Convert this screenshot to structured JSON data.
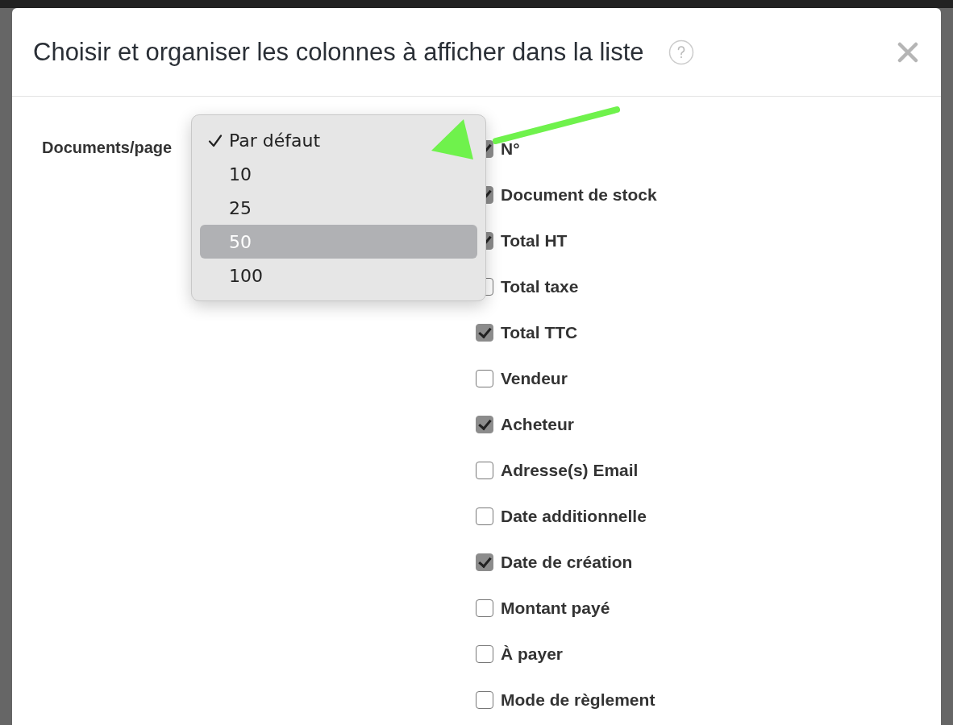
{
  "dialog": {
    "title": "Choisir et organiser les colonnes à afficher dans la liste",
    "page_size": {
      "label": "Documents/page",
      "options": [
        {
          "label": "Par défaut",
          "selected": true,
          "highlighted": false
        },
        {
          "label": "10",
          "selected": false,
          "highlighted": false
        },
        {
          "label": "25",
          "selected": false,
          "highlighted": false
        },
        {
          "label": "50",
          "selected": false,
          "highlighted": true
        },
        {
          "label": "100",
          "selected": false,
          "highlighted": false
        }
      ]
    },
    "columns": [
      {
        "label": "N°",
        "checked": true
      },
      {
        "label": "Document de stock",
        "checked": true
      },
      {
        "label": "Total HT",
        "checked": true
      },
      {
        "label": "Total taxe",
        "checked": false
      },
      {
        "label": "Total TTC",
        "checked": true
      },
      {
        "label": "Vendeur",
        "checked": false
      },
      {
        "label": "Acheteur",
        "checked": true
      },
      {
        "label": "Adresse(s) Email",
        "checked": false
      },
      {
        "label": "Date additionnelle",
        "checked": false
      },
      {
        "label": "Date de création",
        "checked": true
      },
      {
        "label": "Montant payé",
        "checked": false
      },
      {
        "label": "À payer",
        "checked": false
      },
      {
        "label": "Mode de règlement",
        "checked": false
      }
    ]
  }
}
